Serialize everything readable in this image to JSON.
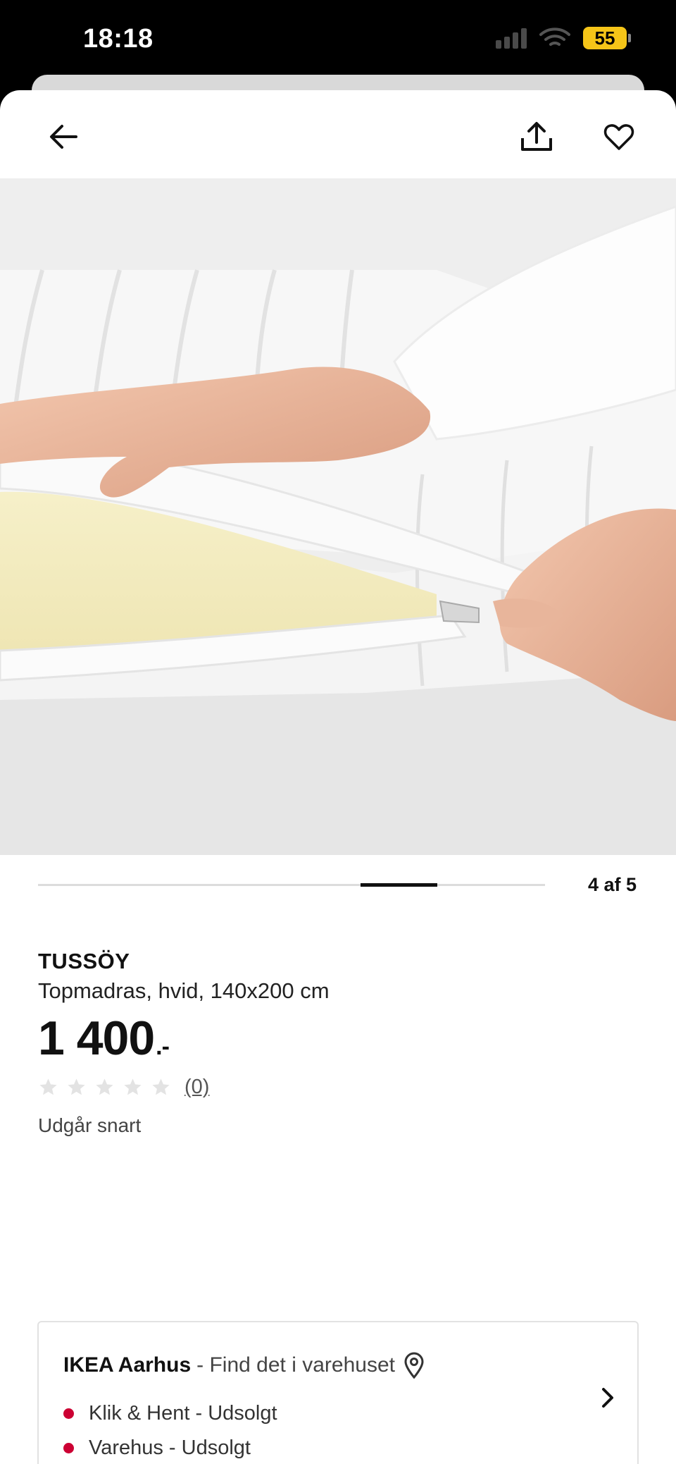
{
  "status_bar": {
    "time": "18:18",
    "battery": "55",
    "battery_color": "#f5c518"
  },
  "header": {
    "back_icon": "arrow-left-icon",
    "share_icon": "share-icon",
    "favorite_icon": "heart-icon"
  },
  "gallery": {
    "position_label": "4 af 5",
    "current": 4,
    "total": 5
  },
  "product": {
    "name": "TUSSÖY",
    "description": "Topmadras, hvid, 140x200 cm",
    "price": "1 400",
    "price_suffix": ".-",
    "rating_count": "(0)",
    "stars_filled": 0,
    "stars_total": 5,
    "status": "Udgår snart"
  },
  "store": {
    "name": "IKEA Aarhus",
    "subtitle": "- Find det i varehuset",
    "availability": [
      {
        "label": "Klik & Hent - Udsolgt",
        "status_color": "#cc0033"
      },
      {
        "label": "Varehus - Udsolgt",
        "status_color": "#cc0033"
      }
    ]
  }
}
